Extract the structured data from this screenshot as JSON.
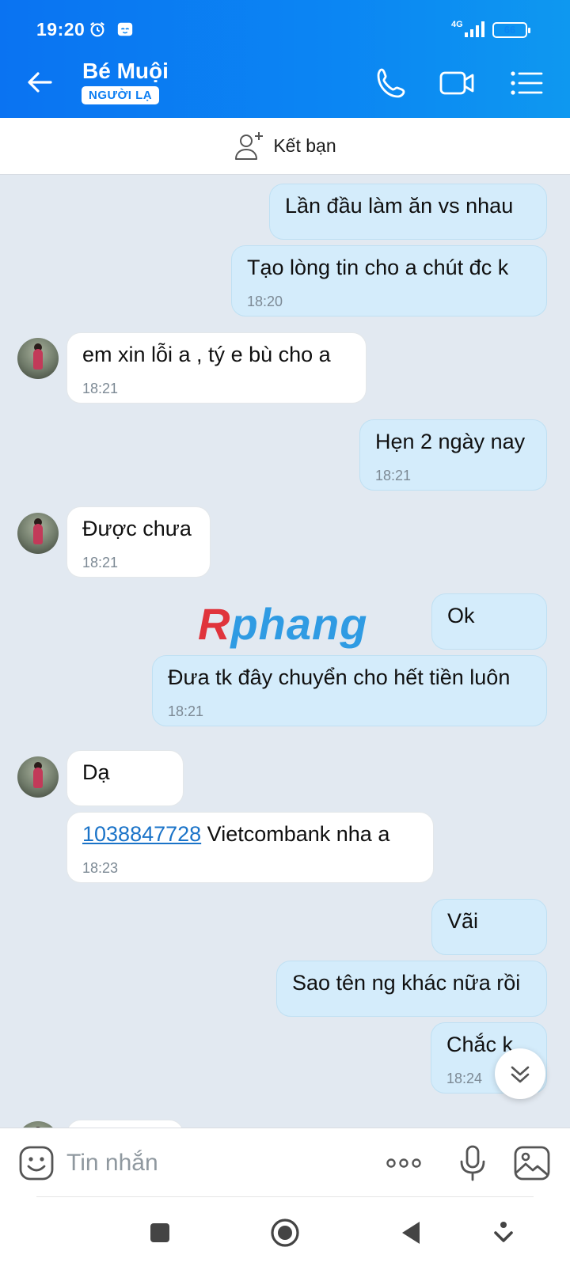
{
  "status_bar": {
    "time": "19:20",
    "network": "4G",
    "battery": "66",
    "battery_level": 0.66
  },
  "header": {
    "contact_name": "Bé Muội",
    "badge": "NGƯỜI LẠ",
    "icons": [
      "back-arrow-icon",
      "phone-icon",
      "video-call-icon",
      "menu-icon"
    ]
  },
  "add_friend": {
    "label": "Kết bạn",
    "icon": "add-person-icon"
  },
  "messages": [
    {
      "side": "out",
      "text": "Lần đầu làm ăn vs nhau"
    },
    {
      "side": "out",
      "text": "Tạo lòng tin cho a chút đc k",
      "time": "18:20"
    },
    {
      "side": "in",
      "text": "em xin lỗi a , tý e bù cho a",
      "time": "18:21"
    },
    {
      "side": "out",
      "text": "Hẹn 2 ngày nay",
      "time": "18:21"
    },
    {
      "side": "in",
      "text": "Được chưa",
      "time": "18:21"
    },
    {
      "side": "out",
      "text": "Ok"
    },
    {
      "side": "out",
      "text": "Đưa tk đây chuyển cho hết tiền luôn",
      "time": "18:21"
    },
    {
      "side": "in",
      "text": "Dạ"
    },
    {
      "side": "in",
      "link": "1038847728",
      "text": " Vietcombank nha a",
      "time": "18:23"
    },
    {
      "side": "out",
      "text": "Vãi"
    },
    {
      "side": "out",
      "text": "Sao tên ng khác nữa rồi"
    },
    {
      "side": "out",
      "text": "Chắc k",
      "time": "18:24"
    }
  ],
  "watermark": {
    "first": "R",
    "rest": "phang"
  },
  "composer": {
    "placeholder": "Tin nhắn",
    "icons": [
      "emoji-icon",
      "more-icon",
      "microphone-icon",
      "image-icon"
    ]
  },
  "nav_bar": {
    "icons": [
      "recent-apps-icon",
      "home-icon",
      "back-icon",
      "notification-pull-icon"
    ]
  },
  "colors": {
    "header_start": "#0a73f2",
    "header_end": "#0e98f0",
    "chat_bg": "#e2e9f1",
    "outgoing_bubble": "#d4ecfb",
    "incoming_bubble": "#ffffff",
    "link": "#1a73c8"
  }
}
